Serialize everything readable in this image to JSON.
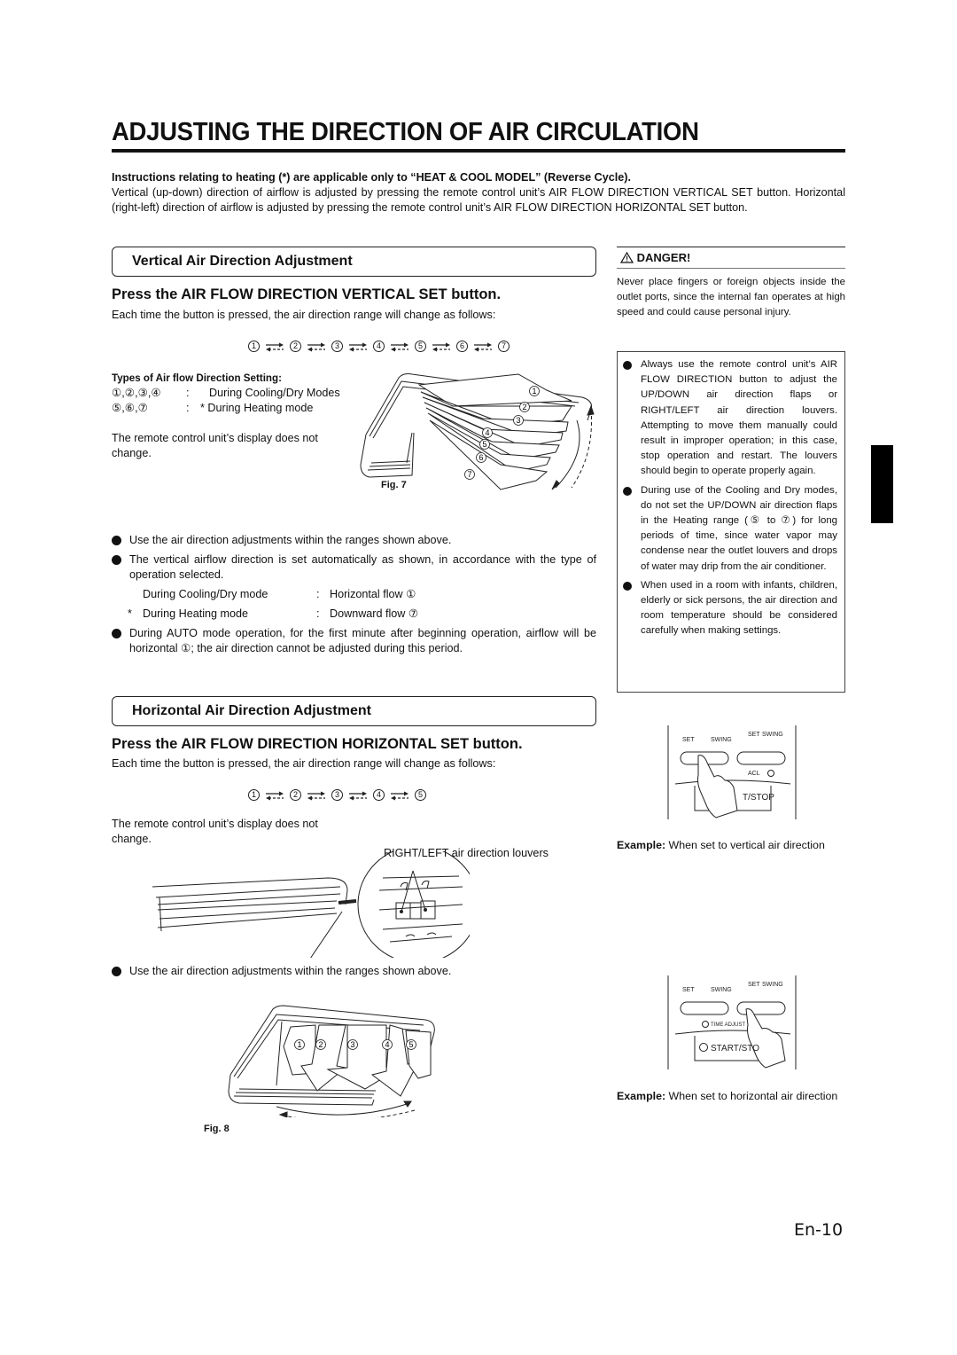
{
  "page": {
    "title": "ADJUSTING THE DIRECTION OF AIR CIRCULATION",
    "page_number": "En-10"
  },
  "intro": {
    "bold_line": "Instructions relating to heating (*) are applicable only to “HEAT & COOL MODEL” (Reverse Cycle).",
    "text": "Vertical (up-down) direction of airflow is adjusted by pressing the remote control unit’s AIR FLOW DIRECTION VERTICAL SET button. Horizontal (right-left) direction of airflow is adjusted by pressing the remote control unit’s AIR FLOW DIRECTION HORIZONTAL SET button."
  },
  "vertical": {
    "section_title": "Vertical Air Direction Adjustment",
    "instruction": "Press the AIR FLOW DIRECTION VERTICAL SET button.",
    "description": "Each time the button is pressed, the air direction range will change as follows:",
    "sequence": [
      "1",
      "2",
      "3",
      "4",
      "5",
      "6",
      "7"
    ],
    "types_heading": "Types of Air flow Direction Setting:",
    "types": [
      {
        "positions": "①,②,③,④",
        "sep": ":",
        "mode": "During Cooling/Dry Modes"
      },
      {
        "positions": "⑤,⑥,⑦",
        "sep": ":",
        "mode": "* During Heating mode"
      }
    ],
    "display_note": "The remote control unit’s display does not change.",
    "figure_label": "Fig. 7",
    "figure_flap_labels": [
      "1",
      "2",
      "3",
      "4",
      "5",
      "6",
      "7"
    ],
    "bullets": [
      "Use the air direction adjustments within the ranges shown above.",
      "The vertical airflow direction is set automatically as shown, in accordance with the type of operation selected.",
      "During AUTO mode operation, for the first minute after beginning operation, airflow will be horizontal ①; the air direction cannot be adjusted during this period."
    ],
    "auto_settings": [
      {
        "prefix": "",
        "mode": "During Cooling/Dry mode",
        "sep": ":",
        "flow": "Horizontal flow ①"
      },
      {
        "prefix": "*",
        "mode": "During Heating mode",
        "sep": ":",
        "flow": "Downward flow ⑦"
      }
    ]
  },
  "horizontal": {
    "section_title": "Horizontal Air Direction Adjustment",
    "instruction": "Press the AIR FLOW DIRECTION HORIZONTAL SET button.",
    "description": "Each time the button is pressed, the air direction range will change as follows:",
    "sequence": [
      "1",
      "2",
      "3",
      "4",
      "5"
    ],
    "display_note": "The remote control unit’s display does not change.",
    "louver_label": "RIGHT/LEFT air direction louvers",
    "bullet": "Use the air direction adjustments within the ranges shown above.",
    "figure_label": "Fig. 8",
    "figure_arrow_labels": [
      "1",
      "2",
      "3",
      "4",
      "5"
    ]
  },
  "danger": {
    "heading": "DANGER!",
    "text": "Never place fingers or foreign objects inside the outlet ports, since the internal fan operates at high speed and could cause personal injury.",
    "bullets": [
      "Always use the remote control unit’s AIR FLOW DIRECTION button to adjust the UP/DOWN air direction flaps or RIGHT/LEFT air direction louvers. Attempting to move them manually could result in improper operation; in this case, stop operation and restart. The louvers should begin to operate properly again.",
      "During use of the Cooling and Dry modes, do not set the UP/DOWN air direction flaps in the Heating range (⑤ to ⑦) for long periods of time, since water vapor may condense near the outlet louvers and drops of water may drip from the air conditioner.",
      "When used in a room with infants, children, elderly or sick persons, the air direction and room temperature should be considered carefully when making settings."
    ]
  },
  "remote": {
    "labels": {
      "set": "SET",
      "swing": "SWING",
      "time_adjust": "TIME ADJUST",
      "acl": "ACL",
      "start_stop": "START/STOP"
    },
    "example1_label": "Example:",
    "example1_text": "When set to vertical air direction",
    "example2_label": "Example:",
    "example2_text": "When set to horizontal air direction"
  }
}
